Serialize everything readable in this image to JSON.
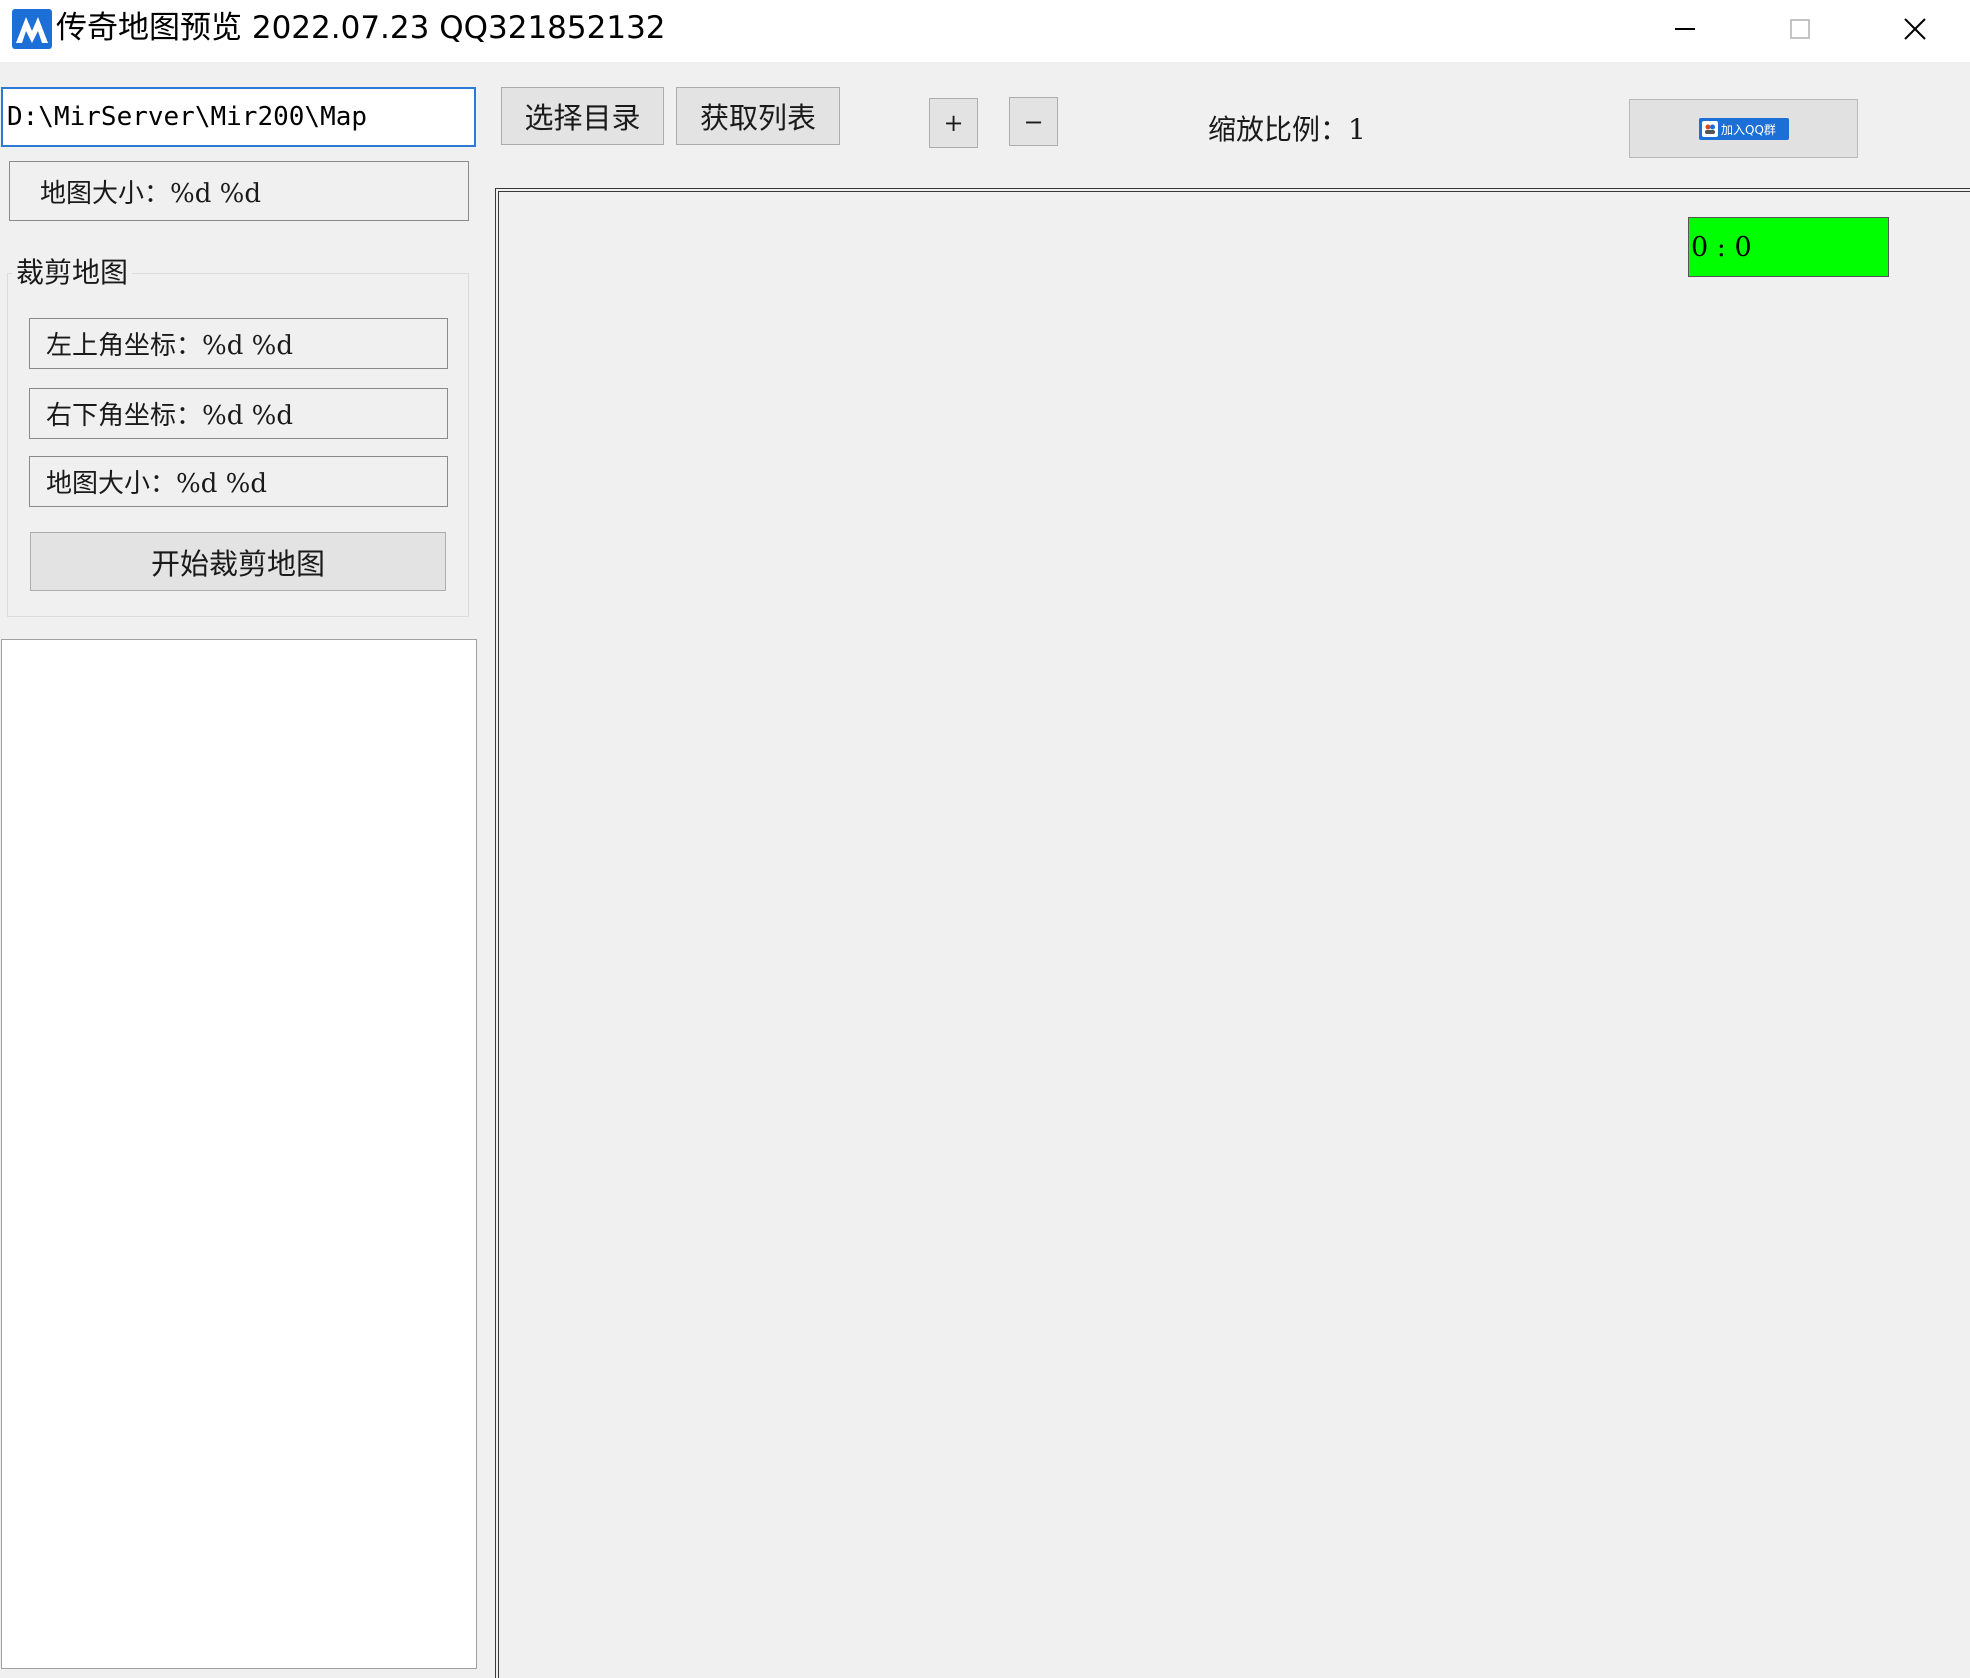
{
  "window": {
    "title": "传奇地图预览 2022.07.23 QQ321852132",
    "minimize_icon": "minimize-icon",
    "maximize_icon": "maximize-icon",
    "close_icon": "close-icon"
  },
  "toolbar": {
    "path_value": "D:\\MirServer\\Mir200\\Map",
    "select_dir_label": "选择目录",
    "get_list_label": "获取列表",
    "zoom_in_label": "+",
    "zoom_out_label": "−",
    "zoom_ratio_text": "缩放比例：1",
    "qq_group_label": "加入QQ群"
  },
  "left_panel": {
    "map_size_text": "地图大小：%d  %d"
  },
  "crop": {
    "title": "裁剪地图",
    "top_left_text": "左上角坐标：%d  %d",
    "bottom_right_text": "右下角坐标：%d  %d",
    "map_size_text": "地图大小：%d  %d",
    "start_button_label": "开始裁剪地图"
  },
  "canvas": {
    "coord_readout": "0 : 0",
    "coord_bg_color": "#00ff00"
  },
  "colors": {
    "app_icon": "#1b6fd6",
    "input_focus_border": "#2b7bd4"
  }
}
